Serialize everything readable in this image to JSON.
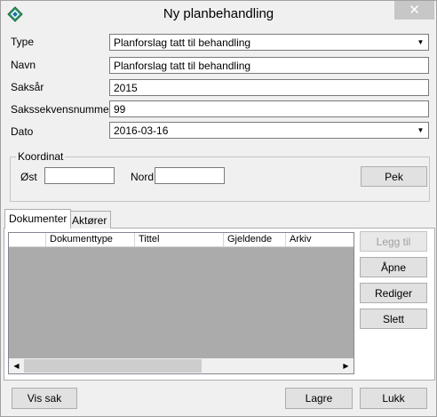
{
  "window": {
    "title": "Ny planbehandling"
  },
  "form": {
    "type_label": "Type",
    "type_value": "Planforslag tatt til behandling",
    "navn_label": "Navn",
    "navn_value": "Planforslag tatt til behandling",
    "saksar_label": "Saksår",
    "saksar_value": "2015",
    "sakssekvensnummer_label": "Sakssekvensnummer",
    "sakssekvensnummer_value": "99",
    "dato_label": "Dato",
    "dato_value": "2016-03-16"
  },
  "koordinat": {
    "group_label": "Koordinat",
    "ost_label": "Øst",
    "ost_value": "",
    "nord_label": "Nord",
    "nord_value": "",
    "pek_label": "Pek"
  },
  "tabs": [
    {
      "label": "Dokumenter",
      "active": true
    },
    {
      "label": "Aktører",
      "active": false
    }
  ],
  "grid": {
    "columns": [
      "",
      "Dokumenttype",
      "Tittel",
      "Gjeldende",
      "Arkiv"
    ],
    "rows": []
  },
  "side_buttons": {
    "legg_til": "Legg til",
    "apne": "Åpne",
    "rediger": "Rediger",
    "slett": "Slett"
  },
  "footer": {
    "vis_sak": "Vis sak",
    "lagre": "Lagre",
    "lukk": "Lukk"
  },
  "icons": {
    "app": "diamond-compass-icon",
    "close": "close-icon",
    "dropdown": "chevron-down-icon",
    "scroll_left": "arrow-left-icon",
    "scroll_right": "arrow-right-icon"
  }
}
